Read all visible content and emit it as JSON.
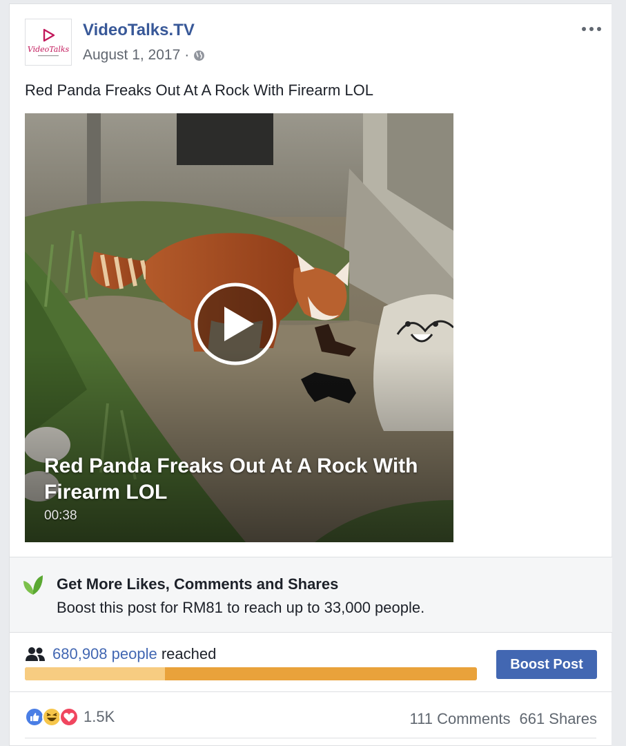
{
  "post": {
    "page_name": "VideoTalks.TV",
    "logo_text": "VideoTalks",
    "date": "August 1, 2017",
    "separator": "·",
    "privacy_icon": "globe-icon",
    "more_icon": "more-options-icon",
    "text": "Red Panda Freaks Out At A Rock With Firearm LOL"
  },
  "video": {
    "title": "Red Panda Freaks Out At A Rock With Firearm LOL",
    "duration": "00:38",
    "play_icon": "play-icon"
  },
  "boost_promo": {
    "icon": "leaf-icon",
    "title": "Get More Likes, Comments and Shares",
    "description": "Boost this post for RM81 to reach up to 33,000 people."
  },
  "reach": {
    "icon": "people-icon",
    "count": "680,908 people",
    "suffix": "reached",
    "organic_fraction": 0.31,
    "colors": {
      "organic": "#f7cc81",
      "paid": "#e9a23b"
    }
  },
  "boost_button": {
    "label": "Boost Post"
  },
  "engagement": {
    "reaction_icons": [
      "like-icon",
      "haha-icon",
      "love-icon"
    ],
    "reactions_count": "1.5K",
    "comments": "111 Comments",
    "shares": "661 Shares"
  },
  "colors": {
    "brand_blue": "#385898",
    "button_blue": "#4267b2",
    "link_blue": "#4267b2",
    "text": "#1d2129",
    "secondary_text": "#606770",
    "logo_pink": "#c2185b",
    "leaf_green": "#67b43f"
  }
}
